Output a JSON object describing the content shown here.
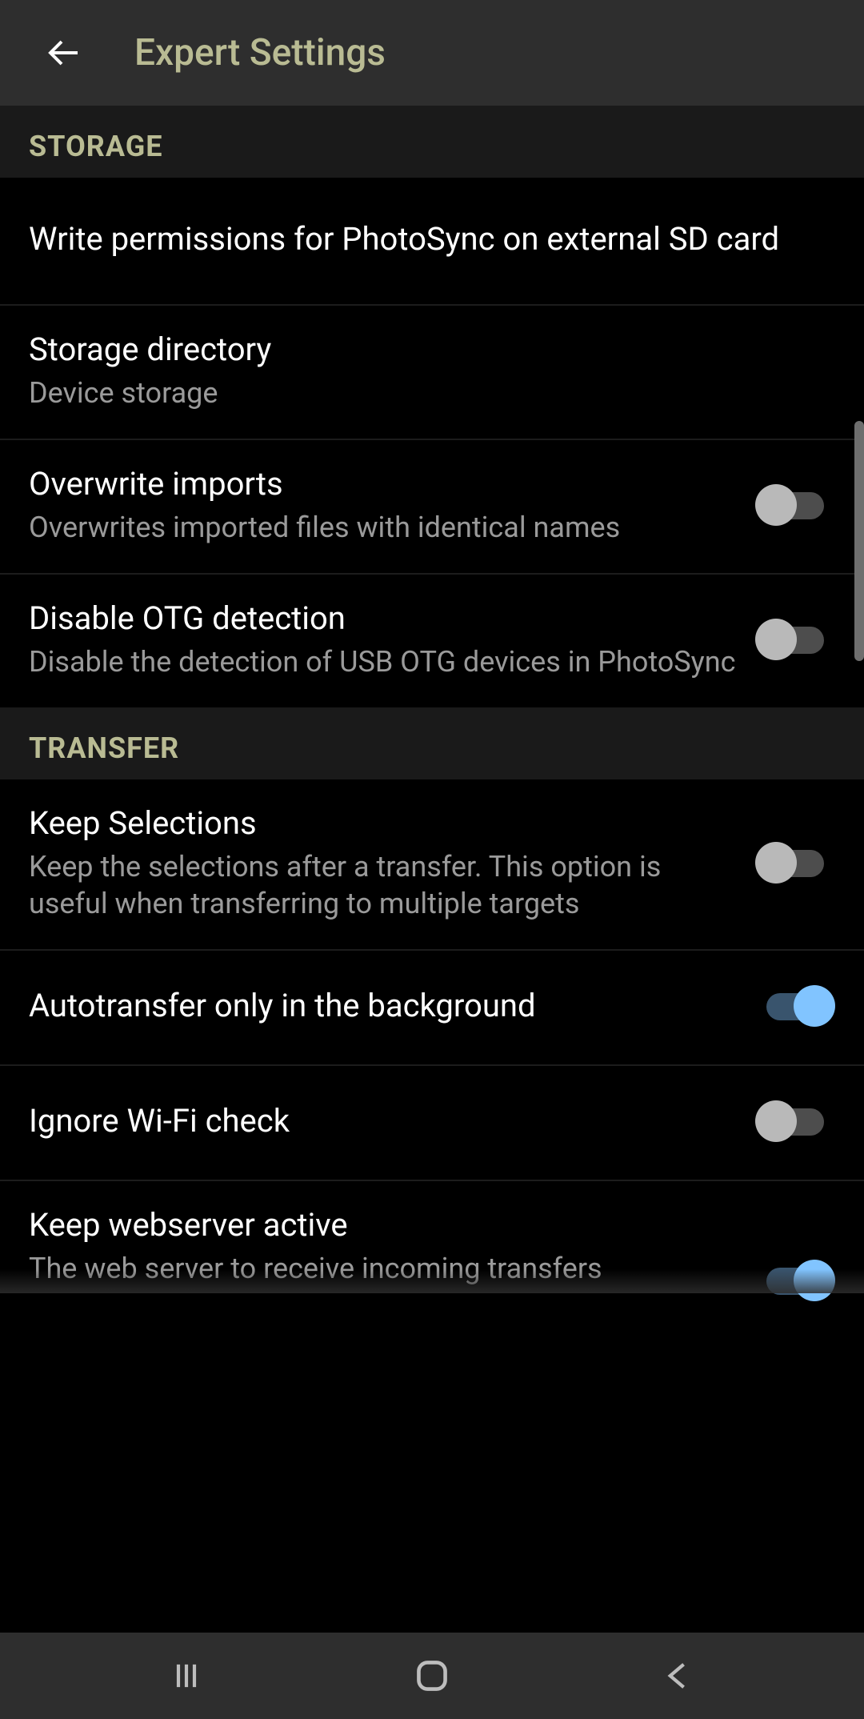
{
  "header": {
    "title": "Expert Settings"
  },
  "sections": {
    "storage": {
      "label": "STORAGE",
      "write_permissions": {
        "title": "Write permissions for PhotoSync on external SD card"
      },
      "storage_directory": {
        "title": "Storage directory",
        "subtitle": "Device storage"
      },
      "overwrite_imports": {
        "title": "Overwrite imports",
        "subtitle": "Overwrites imported files with identical names",
        "enabled": false
      },
      "disable_otg": {
        "title": "Disable OTG detection",
        "subtitle": "Disable the detection of USB OTG devices in PhotoSync",
        "enabled": false
      }
    },
    "transfer": {
      "label": "TRANSFER",
      "keep_selections": {
        "title": "Keep Selections",
        "subtitle": "Keep the selections after a transfer. This option is useful when transferring to multiple targets",
        "enabled": false
      },
      "autotransfer_bg": {
        "title": "Autotransfer only in the background",
        "enabled": true
      },
      "ignore_wifi": {
        "title": "Ignore Wi-Fi check",
        "enabled": false
      },
      "keep_webserver": {
        "title": "Keep webserver active",
        "subtitle": "The web server to receive incoming transfers",
        "enabled": true
      }
    }
  }
}
